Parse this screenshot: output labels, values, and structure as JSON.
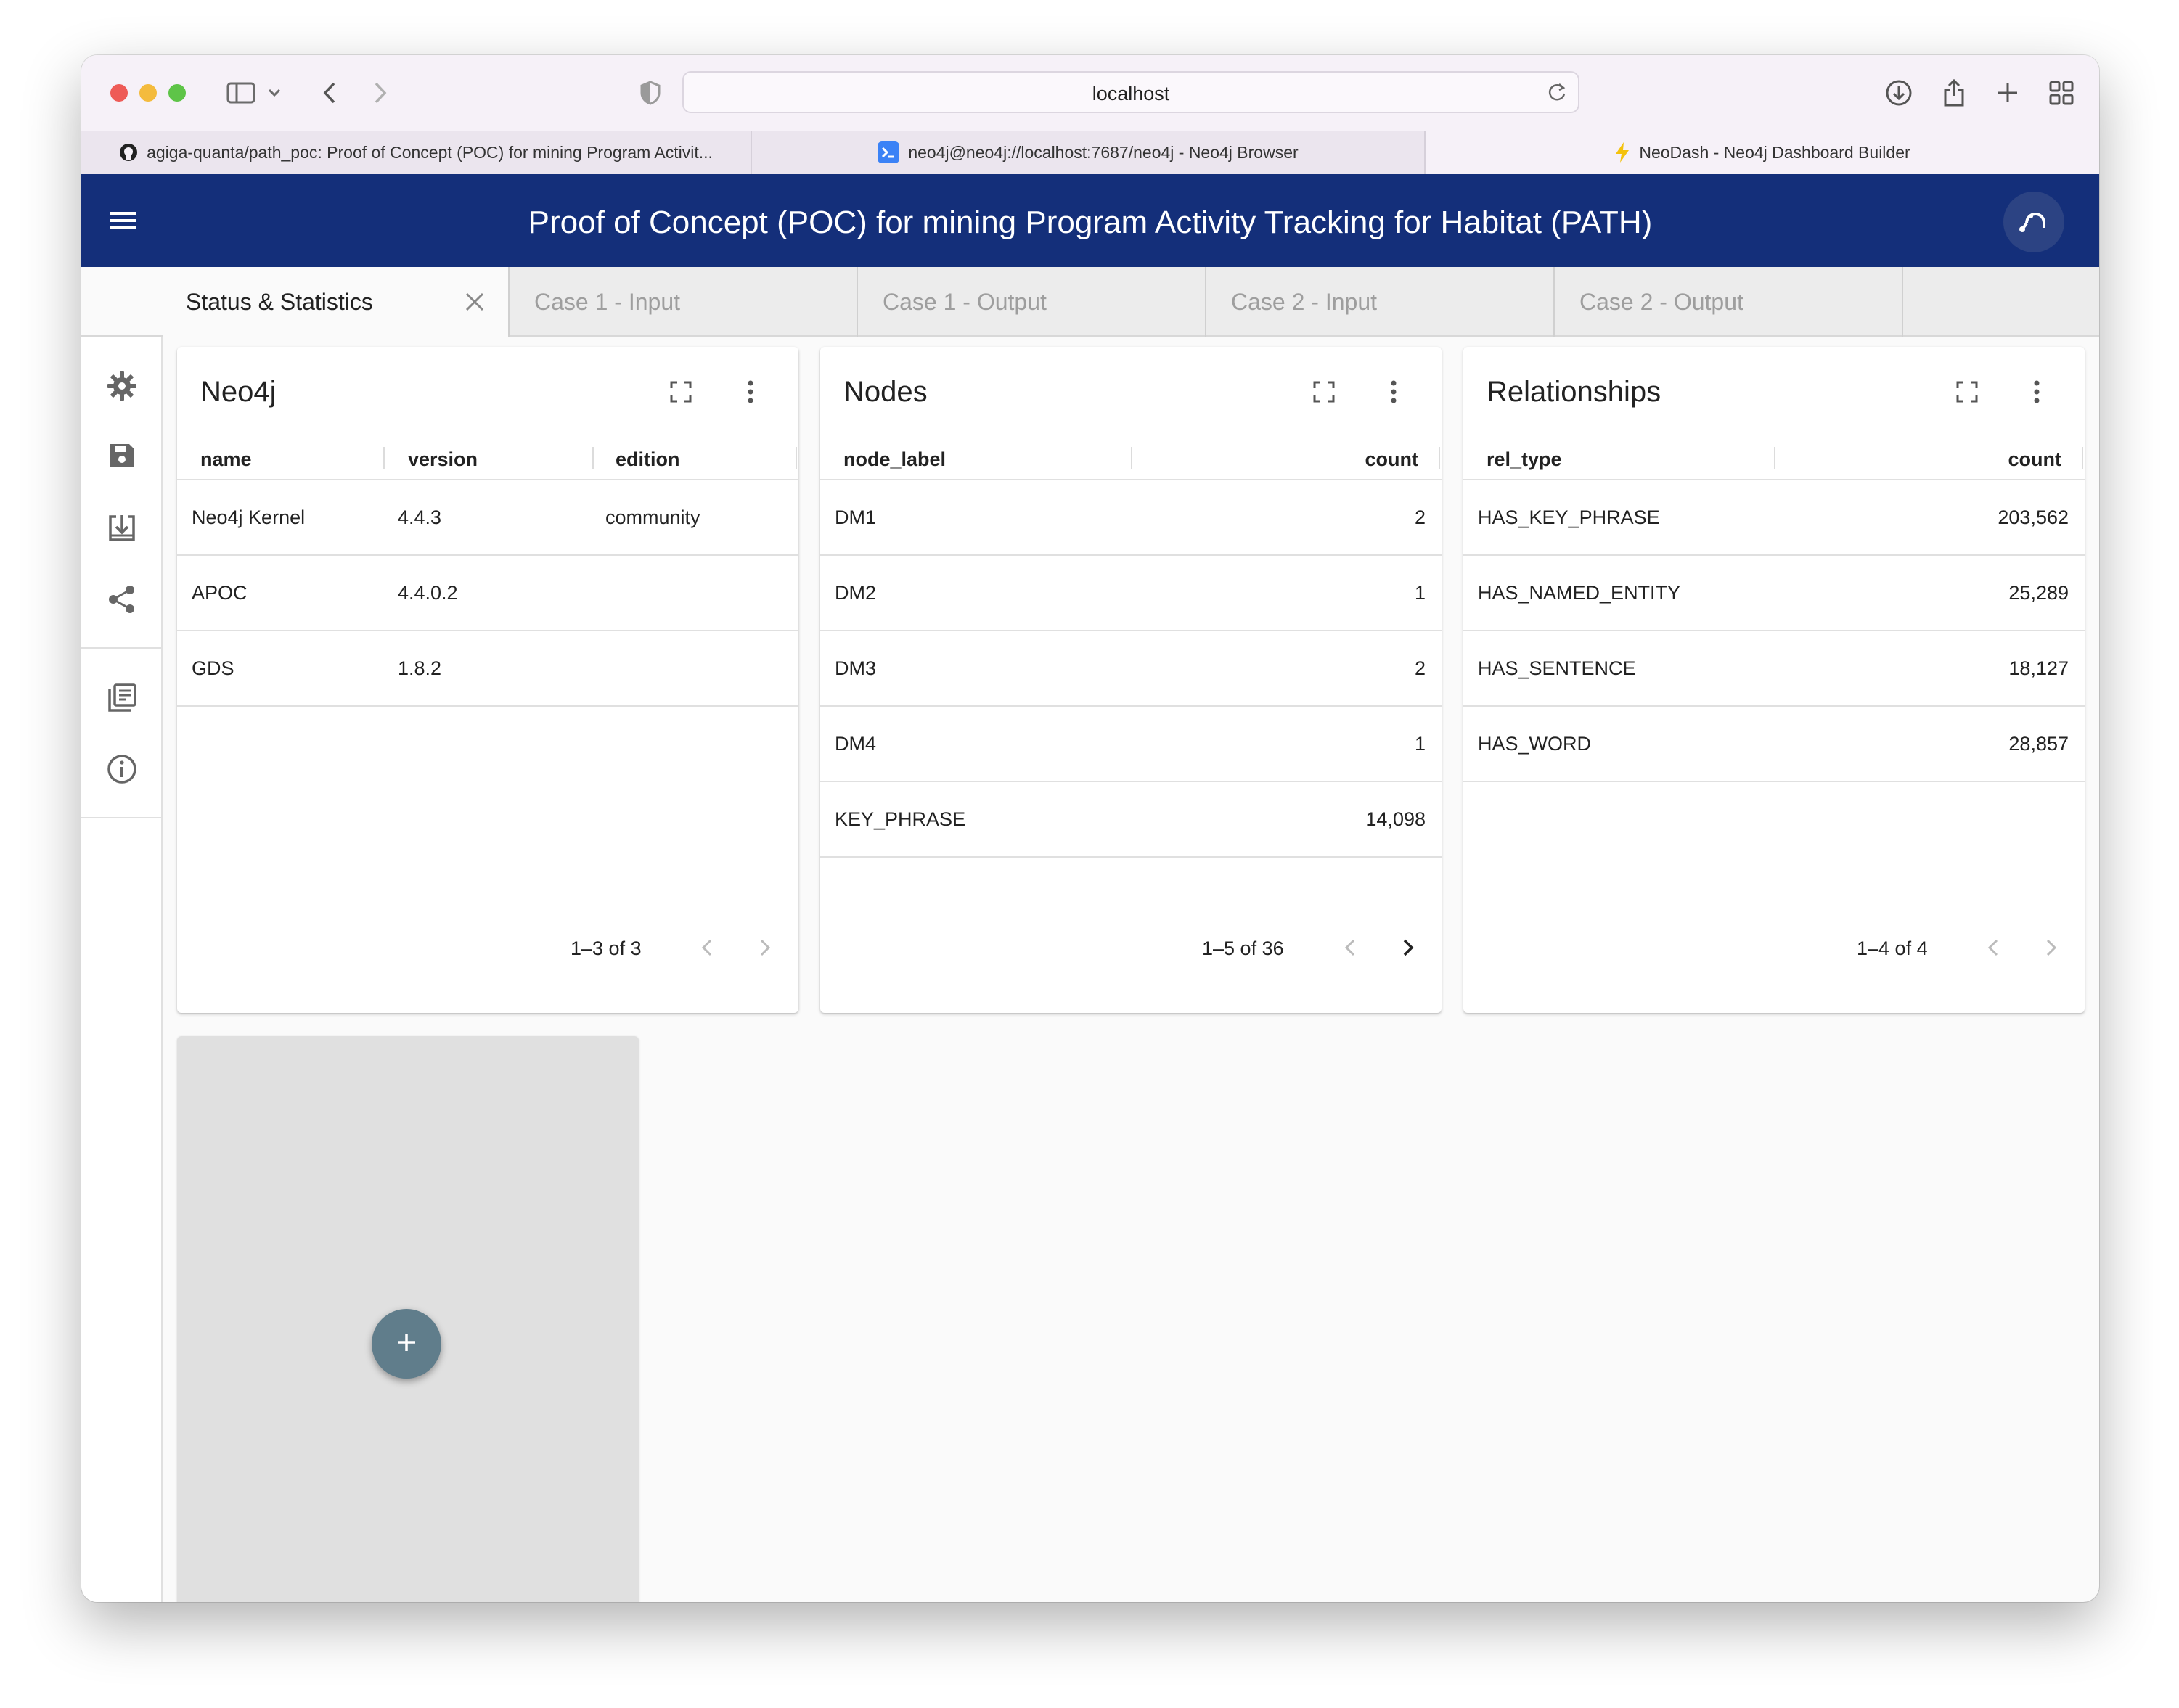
{
  "browser": {
    "url": "localhost",
    "tabs": [
      {
        "title": "agiga-quanta/path_poc: Proof of Concept (POC) for mining Program Activit...",
        "icon": "github-icon"
      },
      {
        "title": "neo4j@neo4j://localhost:7687/neo4j - Neo4j Browser",
        "icon": "terminal-icon"
      },
      {
        "title": "NeoDash - Neo4j Dashboard Builder",
        "icon": "lightning-icon"
      }
    ]
  },
  "app": {
    "title": "Proof of Concept (POC) for mining Program Activity Tracking for Habitat (PATH)",
    "header_color": "#142f7a"
  },
  "pages": [
    {
      "label": "Status & Statistics",
      "active": true
    },
    {
      "label": "Case 1 - Input"
    },
    {
      "label": "Case 1 - Output"
    },
    {
      "label": "Case 2 - Input"
    },
    {
      "label": "Case 2 - Output"
    }
  ],
  "sidebar": [
    "settings-icon",
    "save-icon",
    "load-icon",
    "share-icon",
    "docs-icon",
    "info-icon"
  ],
  "cards": {
    "neo4j": {
      "title": "Neo4j",
      "columns": [
        "name",
        "version",
        "edition"
      ],
      "rows": [
        [
          "Neo4j Kernel",
          "4.4.3",
          "community"
        ],
        [
          "APOC",
          "4.4.0.2",
          ""
        ],
        [
          "GDS",
          "1.8.2",
          ""
        ]
      ],
      "pagination": "1–3 of 3"
    },
    "nodes": {
      "title": "Nodes",
      "columns": [
        "node_label",
        "count"
      ],
      "rows": [
        [
          "DM1",
          "2"
        ],
        [
          "DM2",
          "1"
        ],
        [
          "DM3",
          "2"
        ],
        [
          "DM4",
          "1"
        ],
        [
          "KEY_PHRASE",
          "14,098"
        ]
      ],
      "pagination": "1–5 of 36"
    },
    "relationships": {
      "title": "Relationships",
      "columns": [
        "rel_type",
        "count"
      ],
      "rows": [
        [
          "HAS_KEY_PHRASE",
          "203,562"
        ],
        [
          "HAS_NAMED_ENTITY",
          "25,289"
        ],
        [
          "HAS_SENTENCE",
          "18,127"
        ],
        [
          "HAS_WORD",
          "28,857"
        ]
      ],
      "pagination": "1–4 of 4"
    }
  },
  "add_button": {
    "symbol": "+",
    "color": "#607d8b"
  }
}
